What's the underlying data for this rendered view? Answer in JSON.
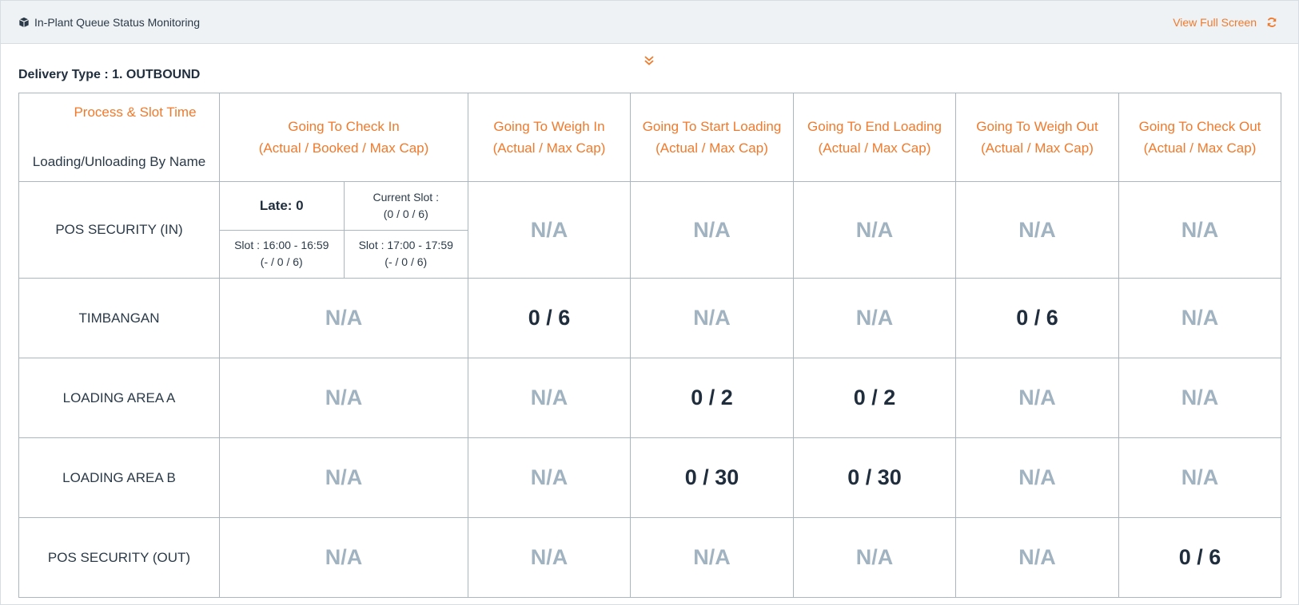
{
  "header": {
    "title": "In-Plant Queue Status Monitoring",
    "view_full_screen": "View Full Screen",
    "accent_color": "#f07a2c"
  },
  "delivery_type": "Delivery Type : 1. OUTBOUND",
  "table": {
    "corner_top": "Process & Slot Time",
    "corner_bottom": "Loading/Unloading By Name",
    "columns": [
      {
        "line1": "Going To Check In",
        "line2": "(Actual / Booked / Max Cap)"
      },
      {
        "line1": "Going To Weigh In",
        "line2": "(Actual / Max Cap)"
      },
      {
        "line1": "Going To Start Loading",
        "line2": "(Actual / Max Cap)"
      },
      {
        "line1": "Going To End Loading",
        "line2": "(Actual / Max Cap)"
      },
      {
        "line1": "Going To Weigh Out",
        "line2": "(Actual / Max Cap)"
      },
      {
        "line1": "Going To Check Out",
        "line2": "(Actual / Max Cap)"
      }
    ],
    "pos_in": {
      "name": "POS SECURITY (IN)",
      "late": "Late: 0",
      "current_slot_label": "Current Slot :",
      "current_slot_value": "(0 / 0 / 6)",
      "slot1_label": "Slot : 16:00 - 16:59",
      "slot1_value": "(- / 0 / 6)",
      "slot2_label": "Slot : 17:00 - 17:59",
      "slot2_value": "(- / 0 / 6)",
      "cells": [
        "N/A",
        "N/A",
        "N/A",
        "N/A",
        "N/A"
      ]
    },
    "rows": [
      {
        "name": "TIMBANGAN",
        "cells": [
          "N/A",
          "0 / 6",
          "N/A",
          "N/A",
          "0 / 6",
          "N/A"
        ]
      },
      {
        "name": "LOADING AREA A",
        "cells": [
          "N/A",
          "N/A",
          "0 / 2",
          "0 / 2",
          "N/A",
          "N/A"
        ]
      },
      {
        "name": "LOADING AREA B",
        "cells": [
          "N/A",
          "N/A",
          "0 / 30",
          "0 / 30",
          "N/A",
          "N/A"
        ]
      },
      {
        "name": "POS SECURITY (OUT)",
        "cells": [
          "N/A",
          "N/A",
          "N/A",
          "N/A",
          "N/A",
          "0 / 6"
        ]
      }
    ]
  }
}
